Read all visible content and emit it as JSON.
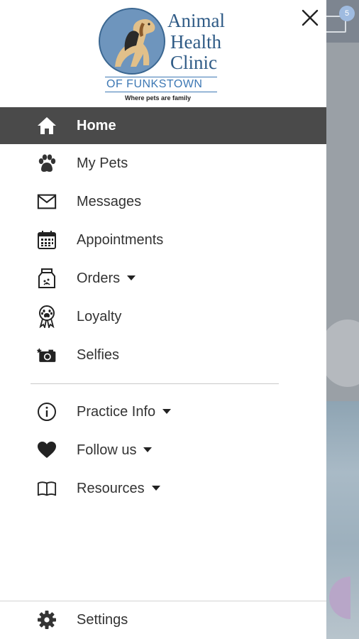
{
  "logo": {
    "line1": "Animal",
    "line2": "Health",
    "line3": "Clinic",
    "subtitle": "OF FUNKSTOWN",
    "tagline": "Where pets are family"
  },
  "background": {
    "badge_count": "5"
  },
  "nav": {
    "items": [
      {
        "label": "Home",
        "icon": "home-icon"
      },
      {
        "label": "My Pets",
        "icon": "paw-icon"
      },
      {
        "label": "Messages",
        "icon": "envelope-icon"
      },
      {
        "label": "Appointments",
        "icon": "calendar-icon"
      },
      {
        "label": "Orders",
        "icon": "pet-food-bag-icon"
      },
      {
        "label": "Loyalty",
        "icon": "paw-ribbon-icon"
      },
      {
        "label": "Selfies",
        "icon": "camera-icon"
      }
    ],
    "secondary": [
      {
        "label": "Practice Info",
        "icon": "info-icon"
      },
      {
        "label": "Follow us",
        "icon": "heart-icon"
      },
      {
        "label": "Resources",
        "icon": "book-icon"
      }
    ],
    "settings": {
      "label": "Settings",
      "icon": "gear-icon"
    }
  },
  "colors": {
    "active_bg": "#4a4a4a",
    "logo_blue": "#2f5b86",
    "text": "#333333"
  }
}
